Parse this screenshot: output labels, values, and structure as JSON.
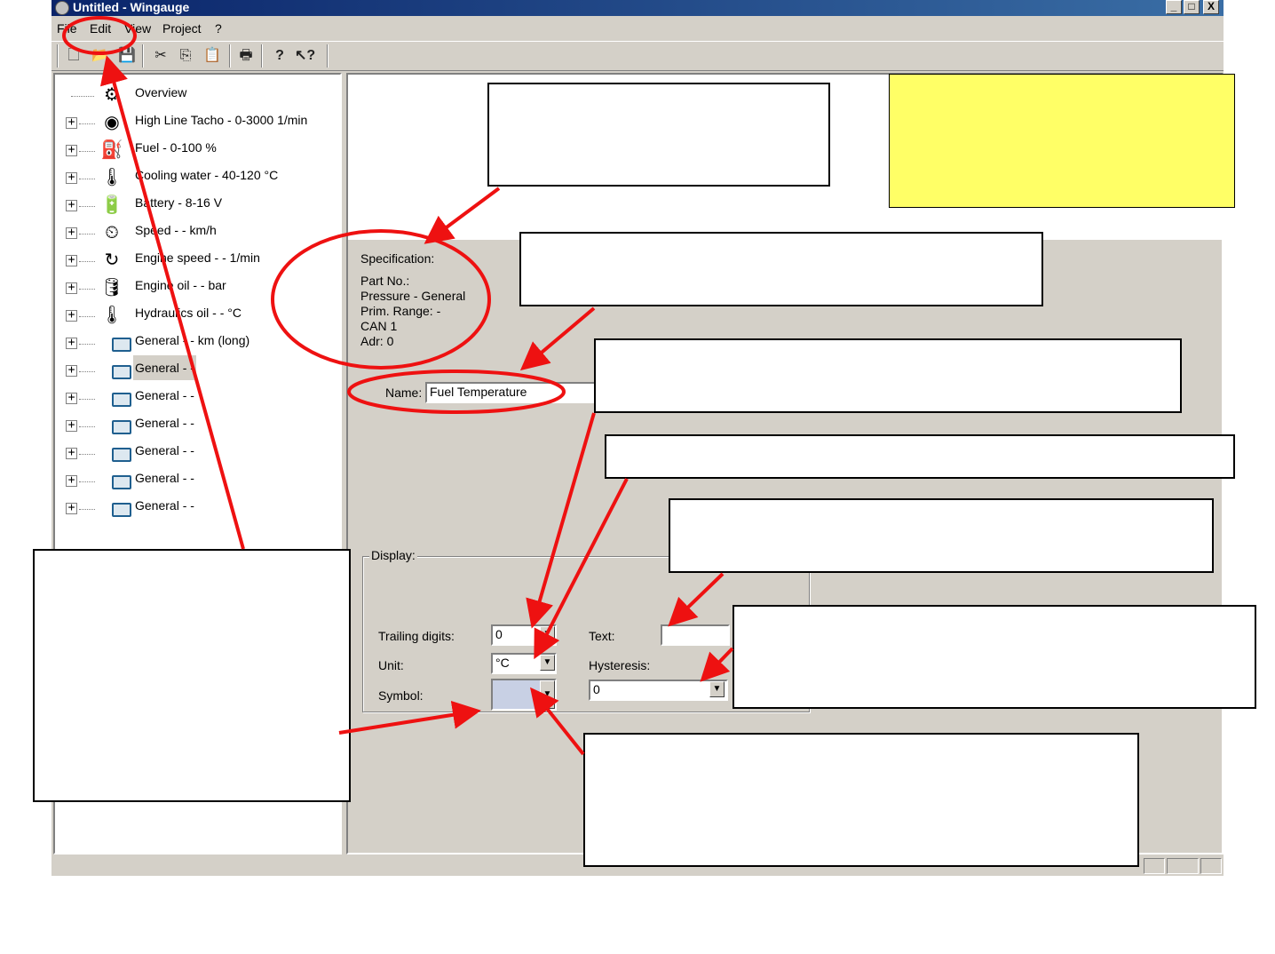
{
  "window": {
    "title": "Untitled - Wingauge",
    "buttons": {
      "minimize": "_",
      "maximize": "□",
      "close": "X"
    }
  },
  "menu": {
    "items": [
      {
        "label": "File"
      },
      {
        "label": "Edit"
      },
      {
        "label": "View"
      },
      {
        "label": "Project"
      },
      {
        "label": "?"
      }
    ]
  },
  "toolbar": {
    "buttons": [
      {
        "icon": "new-document-icon",
        "glyph": "🗋"
      },
      {
        "icon": "open-folder-icon",
        "glyph": "📂"
      },
      {
        "icon": "save-icon",
        "glyph": "💾"
      },
      {
        "icon": "cut-icon",
        "glyph": "✂"
      },
      {
        "icon": "copy-icon",
        "glyph": "⎘"
      },
      {
        "icon": "paste-icon",
        "glyph": "📋"
      },
      {
        "icon": "print-icon",
        "glyph": "🖶"
      },
      {
        "icon": "help-icon",
        "glyph": "?"
      },
      {
        "icon": "context-help-icon",
        "glyph": "↖?"
      }
    ]
  },
  "tree": {
    "items": [
      {
        "label": "Overview",
        "icon": "overview-icon",
        "expandable": false
      },
      {
        "label": "High Line Tacho - 0-3000 1/min",
        "icon": "tachometer-icon",
        "expandable": true
      },
      {
        "label": "Fuel - 0-100 %",
        "icon": "fuel-pump-icon",
        "expandable": true
      },
      {
        "label": "Cooling water - 40-120 °C",
        "icon": "coolant-temperature-icon",
        "expandable": true
      },
      {
        "label": "Battery - 8-16 V",
        "icon": "battery-icon",
        "expandable": true
      },
      {
        "label": "Speed - - km/h",
        "icon": "speed-icon",
        "expandable": true
      },
      {
        "label": "Engine speed - - 1/min",
        "icon": "engine-speed-icon",
        "expandable": true
      },
      {
        "label": "Engine oil - - bar",
        "icon": "oil-can-icon",
        "expandable": true
      },
      {
        "label": "Hydraulics oil - - °C",
        "icon": "hydraulics-oil-icon",
        "expandable": true
      },
      {
        "label": "General - - km (long)",
        "icon": "general-gauge-icon",
        "expandable": true
      },
      {
        "label": "General - -",
        "icon": "general-gauge-icon",
        "expandable": true,
        "selected": true
      },
      {
        "label": "General - -",
        "icon": "general-gauge-icon",
        "expandable": true
      },
      {
        "label": "General - -",
        "icon": "general-gauge-icon",
        "expandable": true
      },
      {
        "label": "General - -",
        "icon": "general-gauge-icon",
        "expandable": true
      },
      {
        "label": "General - -",
        "icon": "general-gauge-icon",
        "expandable": true
      },
      {
        "label": "General - -",
        "icon": "general-gauge-icon",
        "expandable": true
      }
    ]
  },
  "spec": {
    "heading": "Specification:",
    "part_no": "Part No.:",
    "type": "Pressure - General",
    "prim_range": "Prim. Range: -",
    "can": "CAN 1",
    "adr": "Adr: 0"
  },
  "name": {
    "label": "Name:",
    "value": "Fuel Temperature"
  },
  "display": {
    "group_label": "Display:",
    "trailing_digits": {
      "label": "Trailing digits:",
      "value": "0"
    },
    "unit": {
      "label": "Unit:",
      "value": "°C"
    },
    "symbol": {
      "label": "Symbol:",
      "value": ""
    },
    "text": {
      "label": "Text:",
      "value": ""
    },
    "hysteresis": {
      "label": "Hysteresis:",
      "value": "0"
    }
  },
  "colors": {
    "annotation_red": "#ee1111",
    "highlight_yellow": "#ffff66",
    "symbol_swatch": "#c8d0e4"
  }
}
